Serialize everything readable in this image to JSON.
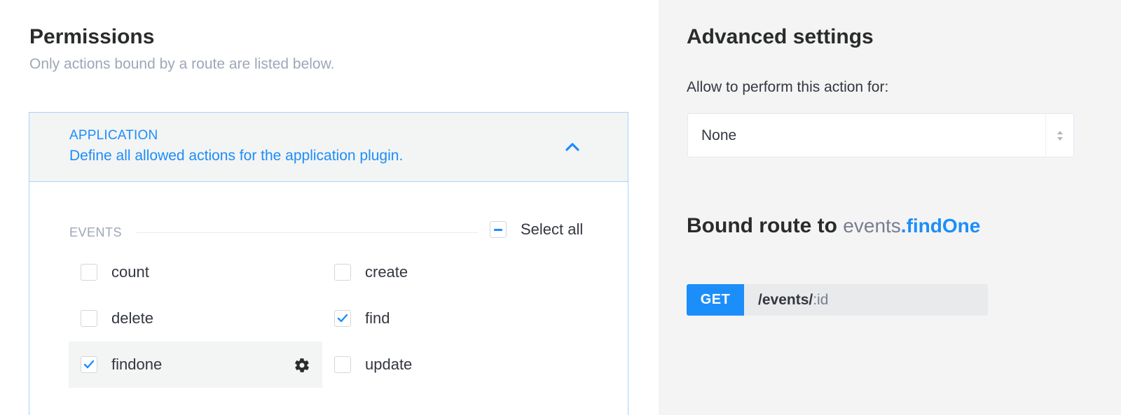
{
  "permissions": {
    "title": "Permissions",
    "subtitle": "Only actions bound by a route are listed below."
  },
  "plugin": {
    "name": "APPLICATION",
    "description": "Define all allowed actions for the application plugin.",
    "expanded": true,
    "accent_color": "#1c8efa",
    "collapse_icon": "chevron-up-icon"
  },
  "controller": {
    "label": "EVENTS",
    "select_all_label": "Select all",
    "select_all_state": "indeterminate",
    "actions": [
      {
        "label": "count",
        "checked": false
      },
      {
        "label": "create",
        "checked": false
      },
      {
        "label": "delete",
        "checked": false
      },
      {
        "label": "find",
        "checked": true
      },
      {
        "label": "findone",
        "checked": true,
        "selected": true,
        "icon": "gear-icon"
      },
      {
        "label": "update",
        "checked": false
      }
    ]
  },
  "advanced": {
    "title": "Advanced settings",
    "allow_label": "Allow to perform this action for:",
    "select_value": "None"
  },
  "bound_route": {
    "title_prefix": "Bound route to",
    "controller": "events",
    "action": ".findOne",
    "method": "GET",
    "path_base": "/events",
    "path_sep": "/",
    "path_param": ":id",
    "method_color": "#1c8efa"
  }
}
